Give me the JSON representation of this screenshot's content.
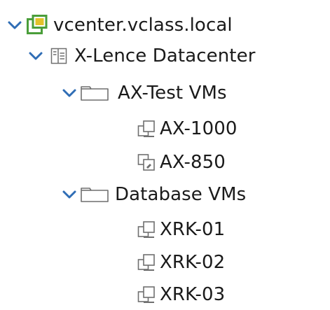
{
  "colors": {
    "chevron": "#2f6db5",
    "vcenter_green": "#4a9e3a",
    "vcenter_yellow": "#e2c22a",
    "icon_gray": "#6f6f6f",
    "text": "#1a1a1a"
  },
  "tree": {
    "vcenter": {
      "label": "vcenter.vclass.local",
      "icon": "vcenter-icon"
    },
    "datacenter": {
      "label": "X-Lence Datacenter",
      "icon": "datacenter-icon"
    },
    "folders": [
      {
        "label": "AX-Test VMs",
        "icon": "folder-icon",
        "vms": [
          {
            "label": "AX-1000",
            "icon": "vm-icon"
          },
          {
            "label": "AX-850",
            "icon": "vm-template-icon"
          }
        ]
      },
      {
        "label": "Database VMs",
        "icon": "folder-icon",
        "vms": [
          {
            "label": "XRK-01",
            "icon": "vm-icon"
          },
          {
            "label": "XRK-02",
            "icon": "vm-icon"
          },
          {
            "label": "XRK-03",
            "icon": "vm-icon"
          }
        ]
      }
    ]
  }
}
